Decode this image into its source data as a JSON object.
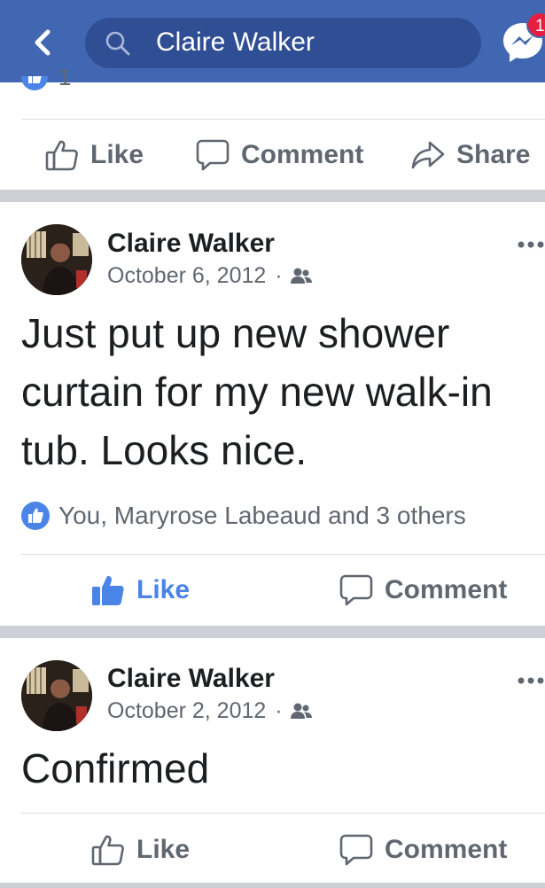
{
  "header": {
    "back_icon": "chevron-left-icon",
    "search_icon": "search-icon",
    "search_value": "Claire Walker",
    "messenger_icon": "messenger-icon",
    "messenger_badge": "1",
    "bar_color": "#4267b2"
  },
  "previous_post": {
    "reaction_count": "1",
    "actions": {
      "like_label": "Like",
      "comment_label": "Comment",
      "share_label": "Share"
    }
  },
  "posts": [
    {
      "author": "Claire Walker",
      "date": "October 6, 2012",
      "dot": "·",
      "audience_icon": "friends-icon",
      "text": "Just put up new shower curtain for my new walk-in tub. Looks nice.",
      "reactions": "You, Maryrose Labeaud and 3 others",
      "liked_by_me": true,
      "actions": {
        "like_label": "Like",
        "comment_label": "Comment"
      }
    },
    {
      "author": "Claire Walker",
      "date": "October 2, 2012",
      "dot": "·",
      "audience_icon": "friends-icon",
      "text": "Confirmed",
      "liked_by_me": false,
      "actions": {
        "like_label": "Like",
        "comment_label": "Comment"
      }
    }
  ],
  "colors": {
    "accent": "#4a84e6",
    "muted_text": "#606770",
    "separator": "#cdd0d4"
  }
}
